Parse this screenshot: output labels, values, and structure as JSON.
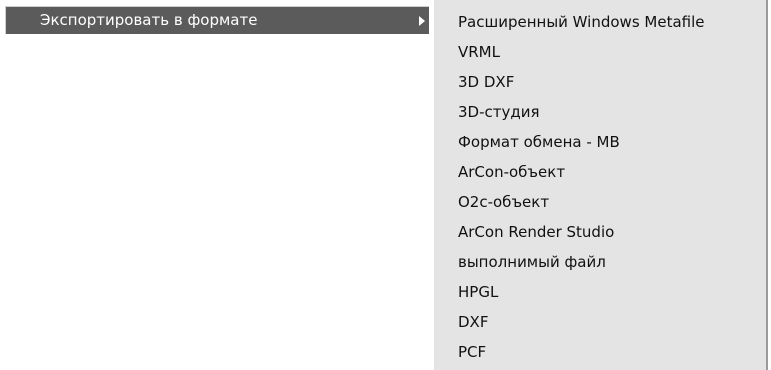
{
  "menu": {
    "parent_item": {
      "label": "Экспортировать в формате",
      "arrow_icon": "submenu-arrow-right"
    },
    "submenu_items": [
      "Расширенный Windows Metafile",
      "VRML",
      "3D DXF",
      "3D-студия",
      "Формат обмена - МВ",
      "ArCon-объект",
      "O2c-объект",
      "ArCon Render Studio",
      "выполнимый файл",
      "HPGL",
      "DXF",
      "PCF"
    ]
  },
  "colors": {
    "highlight_bg": "#5b5b5b",
    "highlight_text": "#ffffff",
    "submenu_bg": "#e4e4e4",
    "submenu_text": "#111111"
  }
}
